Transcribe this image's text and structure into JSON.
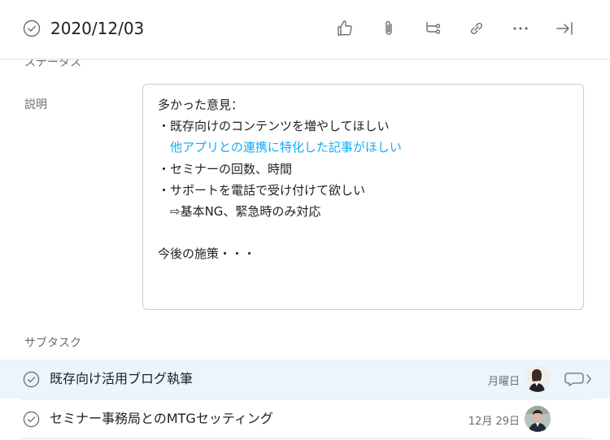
{
  "header": {
    "title": "2020/12/03",
    "icons": [
      "check-circle-icon",
      "thumbs-up-icon",
      "paperclip-icon",
      "subtask-icon",
      "link-icon",
      "more-icon",
      "close-pane-icon"
    ]
  },
  "status_field": {
    "label": "ステータス"
  },
  "description": {
    "label": "説明",
    "lines": [
      "多かった意見：",
      "・既存向けのコンテンツを増やしてほしい",
      "　他アプリとの連携に特化した記事がほしい",
      "・セミナーの回数、時間",
      "・サポートを電話で受け付けて欲しい",
      "　⇨基本NG、緊急時のみ対応",
      "",
      "今後の施策・・・"
    ]
  },
  "subtasks": {
    "label": "サブタスク",
    "items": [
      {
        "name": "既存向け活用ブログ執筆",
        "due": "月曜日",
        "has_comment": true
      },
      {
        "name": "セミナー事務局とのMTGセッティング",
        "due": "12月 29日",
        "has_comment": false
      }
    ]
  },
  "colors": {
    "link": "#14aaf5",
    "highlight_row": "#eaf5fc",
    "muted_text": "#6d6e6f"
  }
}
